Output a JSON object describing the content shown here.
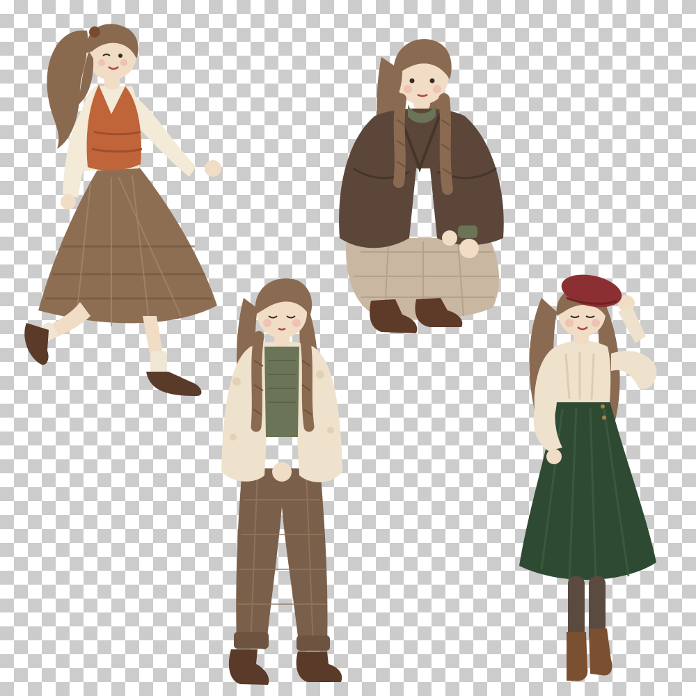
{
  "canvas": {
    "background": "transparency-checkerboard",
    "checker_light": "#ffffff",
    "checker_dark": "#cccccc"
  },
  "figures": [
    {
      "id": "ponytail-girl",
      "pose": "walking-smiling",
      "hair": "#8a6a4e",
      "top": "#f3ead8",
      "vest": "#c0643a",
      "skirt": "#8e6e52",
      "shoes": "#5a3a28"
    },
    {
      "id": "squatting-girl",
      "pose": "squatting",
      "hair": "#8a6a50",
      "jacket": "#5c463a",
      "sweater": "#6b7456",
      "skirt": "#c9b7a2",
      "shoes": "#5e3a28"
    },
    {
      "id": "sherpa-girl",
      "pose": "standing-eyes-closed",
      "hair": "#8a6a50",
      "jacket": "#efe2cc",
      "sweater": "#6b7456",
      "trousers": "#7a5f4a",
      "shoes": "#5a3a28"
    },
    {
      "id": "beret-girl",
      "pose": "standing-hand-on-beret",
      "hair": "#8a6a50",
      "beret": "#8c2f33",
      "sweater": "#efe2cc",
      "skirt": "#2f4a33",
      "tights": "#5a4a40",
      "boots": "#7a5030"
    }
  ]
}
